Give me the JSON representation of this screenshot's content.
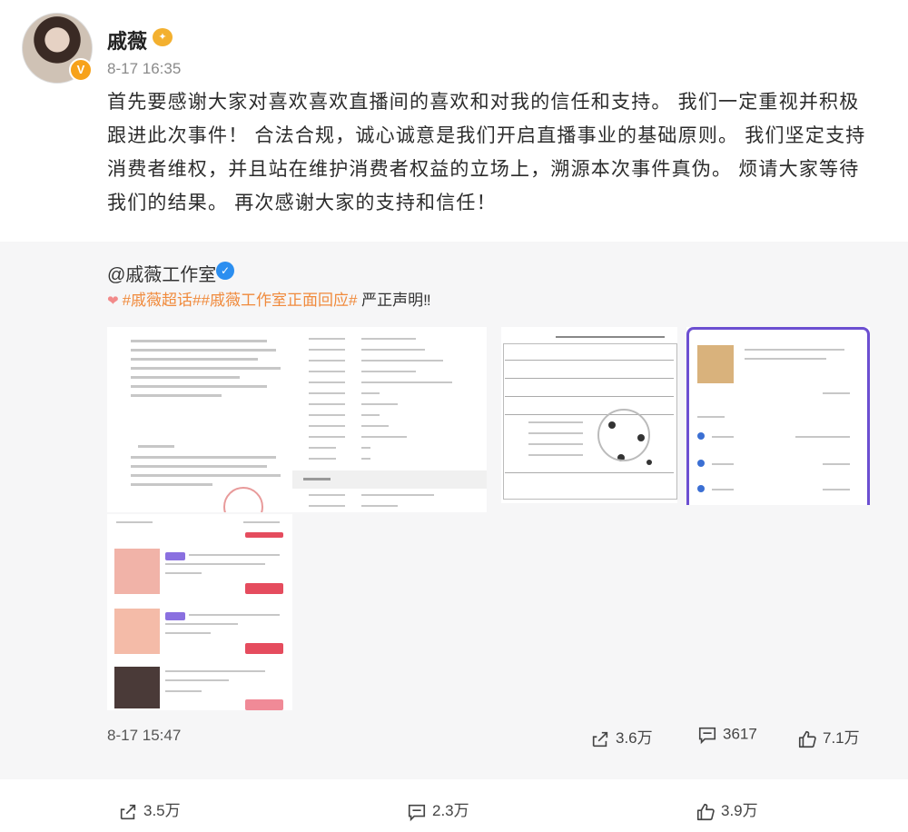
{
  "post": {
    "author": "戚薇",
    "time": "8-17 16:35",
    "text": "首先要感谢大家对喜欢喜欢直播间的喜欢和对我的信任和支持。 我们一定重视并积极跟进此次事件！ 合法合规，诚心诚意是我们开启直播事业的基础原则。 我们坚定支持消费者维权，并且站在维护消费者权益的立场上，溯源本次事件真伪。 烦请大家等待我们的结果。 再次感谢大家的支持和信任！"
  },
  "repost": {
    "author": "@戚薇工作室",
    "tag1": "#戚薇超话#",
    "tag2": "#戚薇工作室正面回应#",
    "statement": " 严正声明‼",
    "time": "8-17 15:47",
    "share_count": "3.6万",
    "comment_count": "3617",
    "like_count": "7.1万"
  },
  "bottom": {
    "share_count": "3.5万",
    "comment_count": "2.3万",
    "like_count": "3.9万"
  },
  "icons": {
    "share": "share-icon",
    "comment": "comment-icon",
    "like": "like-icon",
    "verified": "verified-icon"
  },
  "colors": {
    "tag": "#f08a3c",
    "verified_blue": "#2b8ef0",
    "gold_badge": "#f7a21b",
    "repost_bg": "#f6f6f7"
  }
}
